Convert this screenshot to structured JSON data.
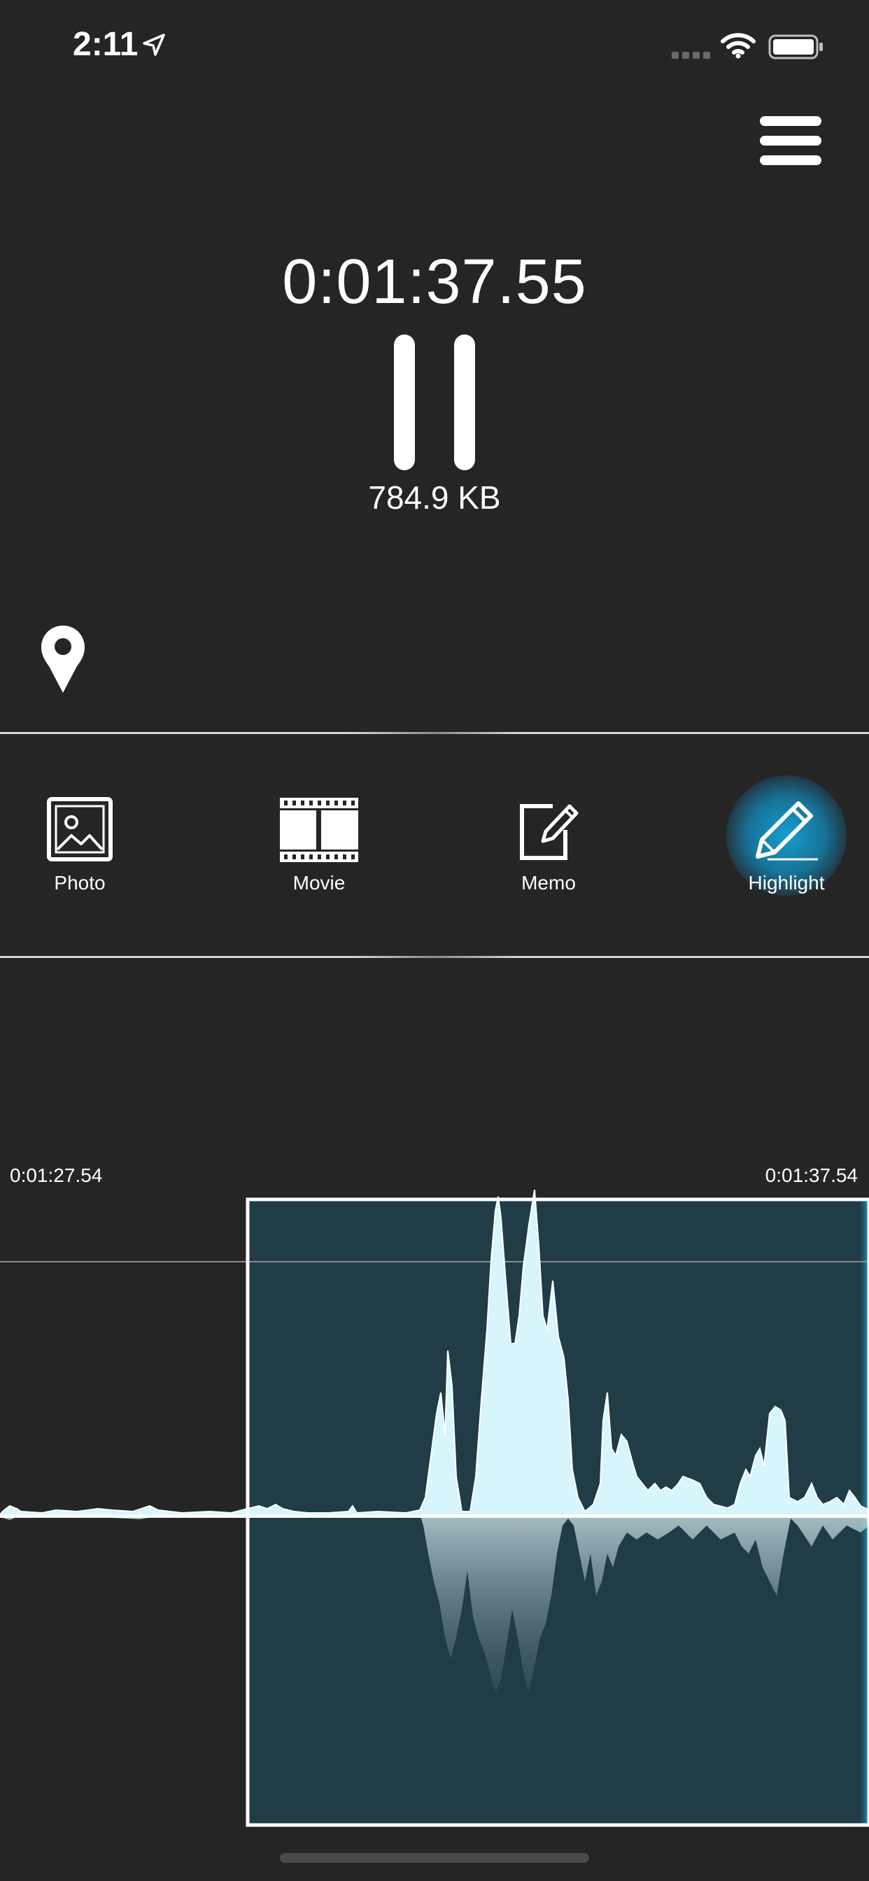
{
  "status_bar": {
    "time": "2:11"
  },
  "recorder": {
    "elapsed": "0:01:37.55",
    "file_size": "784.9 KB"
  },
  "toolbar": {
    "items": [
      {
        "label": "Photo",
        "icon": "photo-icon"
      },
      {
        "label": "Movie",
        "icon": "film-icon"
      },
      {
        "label": "Memo",
        "icon": "memo-edit-icon"
      },
      {
        "label": "Highlight",
        "icon": "pencil-highlight-icon",
        "active": true
      }
    ]
  },
  "waveform": {
    "start_time": "0:01:27.54",
    "end_time": "0:01:37.54"
  },
  "colors": {
    "background": "#252525",
    "highlight_glow": "#14a5d7",
    "wave_fill": "#d6f6fc",
    "selection_bg": "#1f3c47"
  }
}
